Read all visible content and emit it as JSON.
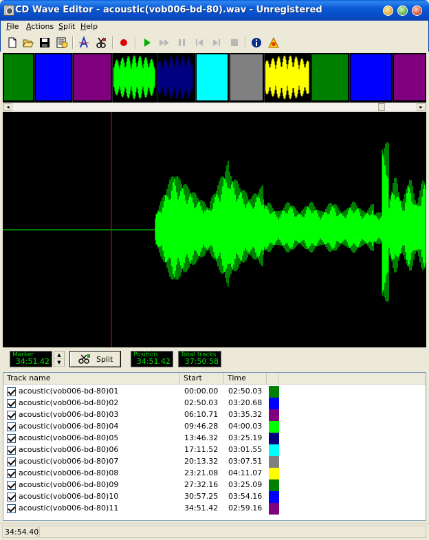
{
  "window": {
    "title": "CD Wave Editor - acoustic(vob006-bd-80).wav - Unregistered"
  },
  "menu": [
    "File",
    "Actions",
    "Split",
    "Help"
  ],
  "toolbar": [
    "new-icon",
    "open-icon",
    "save-icon",
    "properties-icon",
    "auto-split-icon",
    "split-settings-icon",
    "record-icon",
    "play-icon",
    "fast-forward-icon",
    "pause-icon",
    "previous-icon",
    "next-icon",
    "stop-icon",
    "info-icon",
    "help-icon"
  ],
  "controls": {
    "marker_label": "Marker",
    "marker_value": "34:51.42",
    "split_label": "Split",
    "position_label": "Position",
    "position_value": "34:51.42",
    "total_label": "Total tracks",
    "total_value": "37:50.58"
  },
  "colors": {
    "waveform": "#00ff00",
    "marker_line": "#ff0000",
    "background": "#000000"
  },
  "tracks": {
    "headers": [
      "Track name",
      "Start",
      "Time"
    ],
    "rows": [
      {
        "name": "acoustic(vob006-bd-80)01",
        "start": "00:00.00",
        "time": "02:50.03",
        "color": "#008000"
      },
      {
        "name": "acoustic(vob006-bd-80)02",
        "start": "02:50.03",
        "time": "03:20.68",
        "color": "#0000ff"
      },
      {
        "name": "acoustic(vob006-bd-80)03",
        "start": "06:10.71",
        "time": "03:35.32",
        "color": "#800080"
      },
      {
        "name": "acoustic(vob006-bd-80)04",
        "start": "09:46.28",
        "time": "04:00.03",
        "color": "#00ff00"
      },
      {
        "name": "acoustic(vob006-bd-80)05",
        "start": "13:46.32",
        "time": "03:25.19",
        "color": "#000080"
      },
      {
        "name": "acoustic(vob006-bd-80)06",
        "start": "17:11.52",
        "time": "03:01.55",
        "color": "#00ffff"
      },
      {
        "name": "acoustic(vob006-bd-80)07",
        "start": "20:13.32",
        "time": "03:07.51",
        "color": "#808080"
      },
      {
        "name": "acoustic(vob006-bd-80)08",
        "start": "23:21.08",
        "time": "04:11.07",
        "color": "#ffff00"
      },
      {
        "name": "acoustic(vob006-bd-80)09",
        "start": "27:32.16",
        "time": "03:25.09",
        "color": "#008000"
      },
      {
        "name": "acoustic(vob006-bd-80)10",
        "start": "30:57.25",
        "time": "03:54.16",
        "color": "#0000ff"
      },
      {
        "name": "acoustic(vob006-bd-80)11",
        "start": "34:51.42",
        "time": "02:59.16",
        "color": "#800080"
      }
    ]
  },
  "status": {
    "time": "34:54.40"
  }
}
